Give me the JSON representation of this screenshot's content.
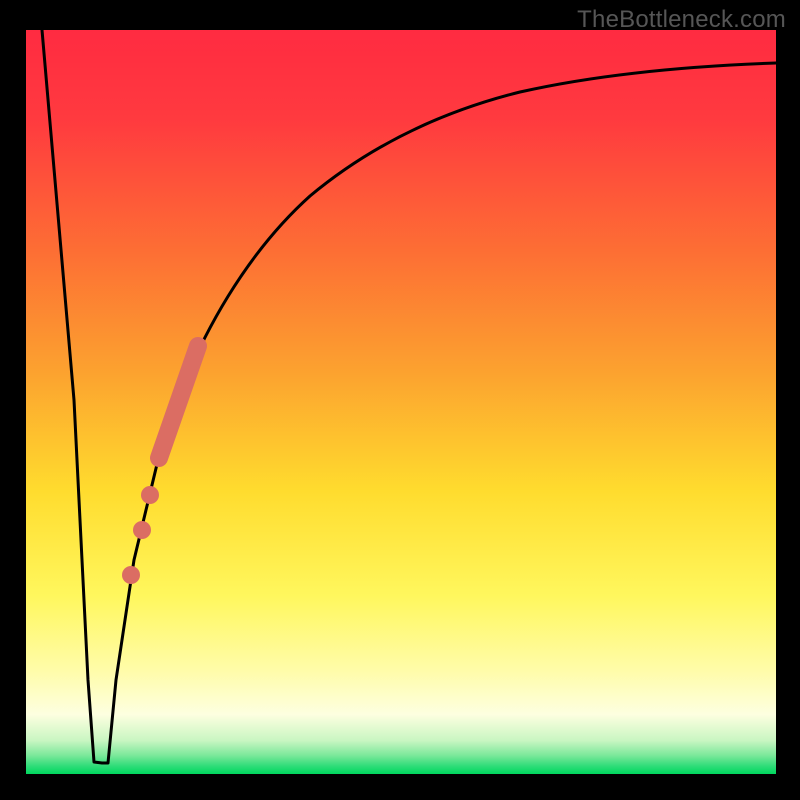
{
  "attribution": "TheBottleneck.com",
  "colors": {
    "background": "#000000",
    "gradient_top": "#ff2b41",
    "gradient_mid_upper": "#fd8a2e",
    "gradient_mid": "#fff22f",
    "gradient_lower": "#fffca0",
    "gradient_bottom_band": "#7be89a",
    "gradient_bottom_edge": "#00d85e",
    "curve_stroke": "#000000",
    "marker": "#db6d63"
  },
  "chart_data": {
    "type": "line",
    "title": "",
    "xlabel": "",
    "ylabel": "",
    "xlim": [
      0,
      100
    ],
    "ylim": [
      0,
      100
    ],
    "grid": false,
    "notes": "No axis ticks or numeric labels are rendered; values are estimated from pixel positions on a 0–100 normalized scale. y is bottleneck-% (0 at bottom, 100 at top).",
    "series": [
      {
        "name": "bottleneck-curve",
        "x": [
          2.0,
          5.0,
          6.8,
          8.3,
          9.5,
          11.0,
          14.0,
          18.0,
          22.0,
          26.0,
          30.0,
          36.0,
          44.0,
          54.0,
          64.0,
          76.0,
          88.0,
          98.0
        ],
        "y": [
          100.0,
          50.0,
          12.0,
          1.5,
          1.5,
          12.0,
          30.0,
          47.0,
          58.0,
          66.0,
          72.0,
          79.0,
          84.5,
          88.5,
          90.5,
          92.3,
          93.3,
          94.0
        ]
      }
    ],
    "optimal_region": {
      "x_start": 8.1,
      "x_end": 9.7,
      "y": 1.5
    },
    "highlighted_segment": {
      "x_start": 16.5,
      "y_start": 42.0,
      "x_end": 21.5,
      "y_end": 57.0
    },
    "marker_points": [
      {
        "x": 15.3,
        "y": 37.0
      },
      {
        "x": 14.3,
        "y": 32.5
      },
      {
        "x": 13.0,
        "y": 26.5
      }
    ]
  }
}
